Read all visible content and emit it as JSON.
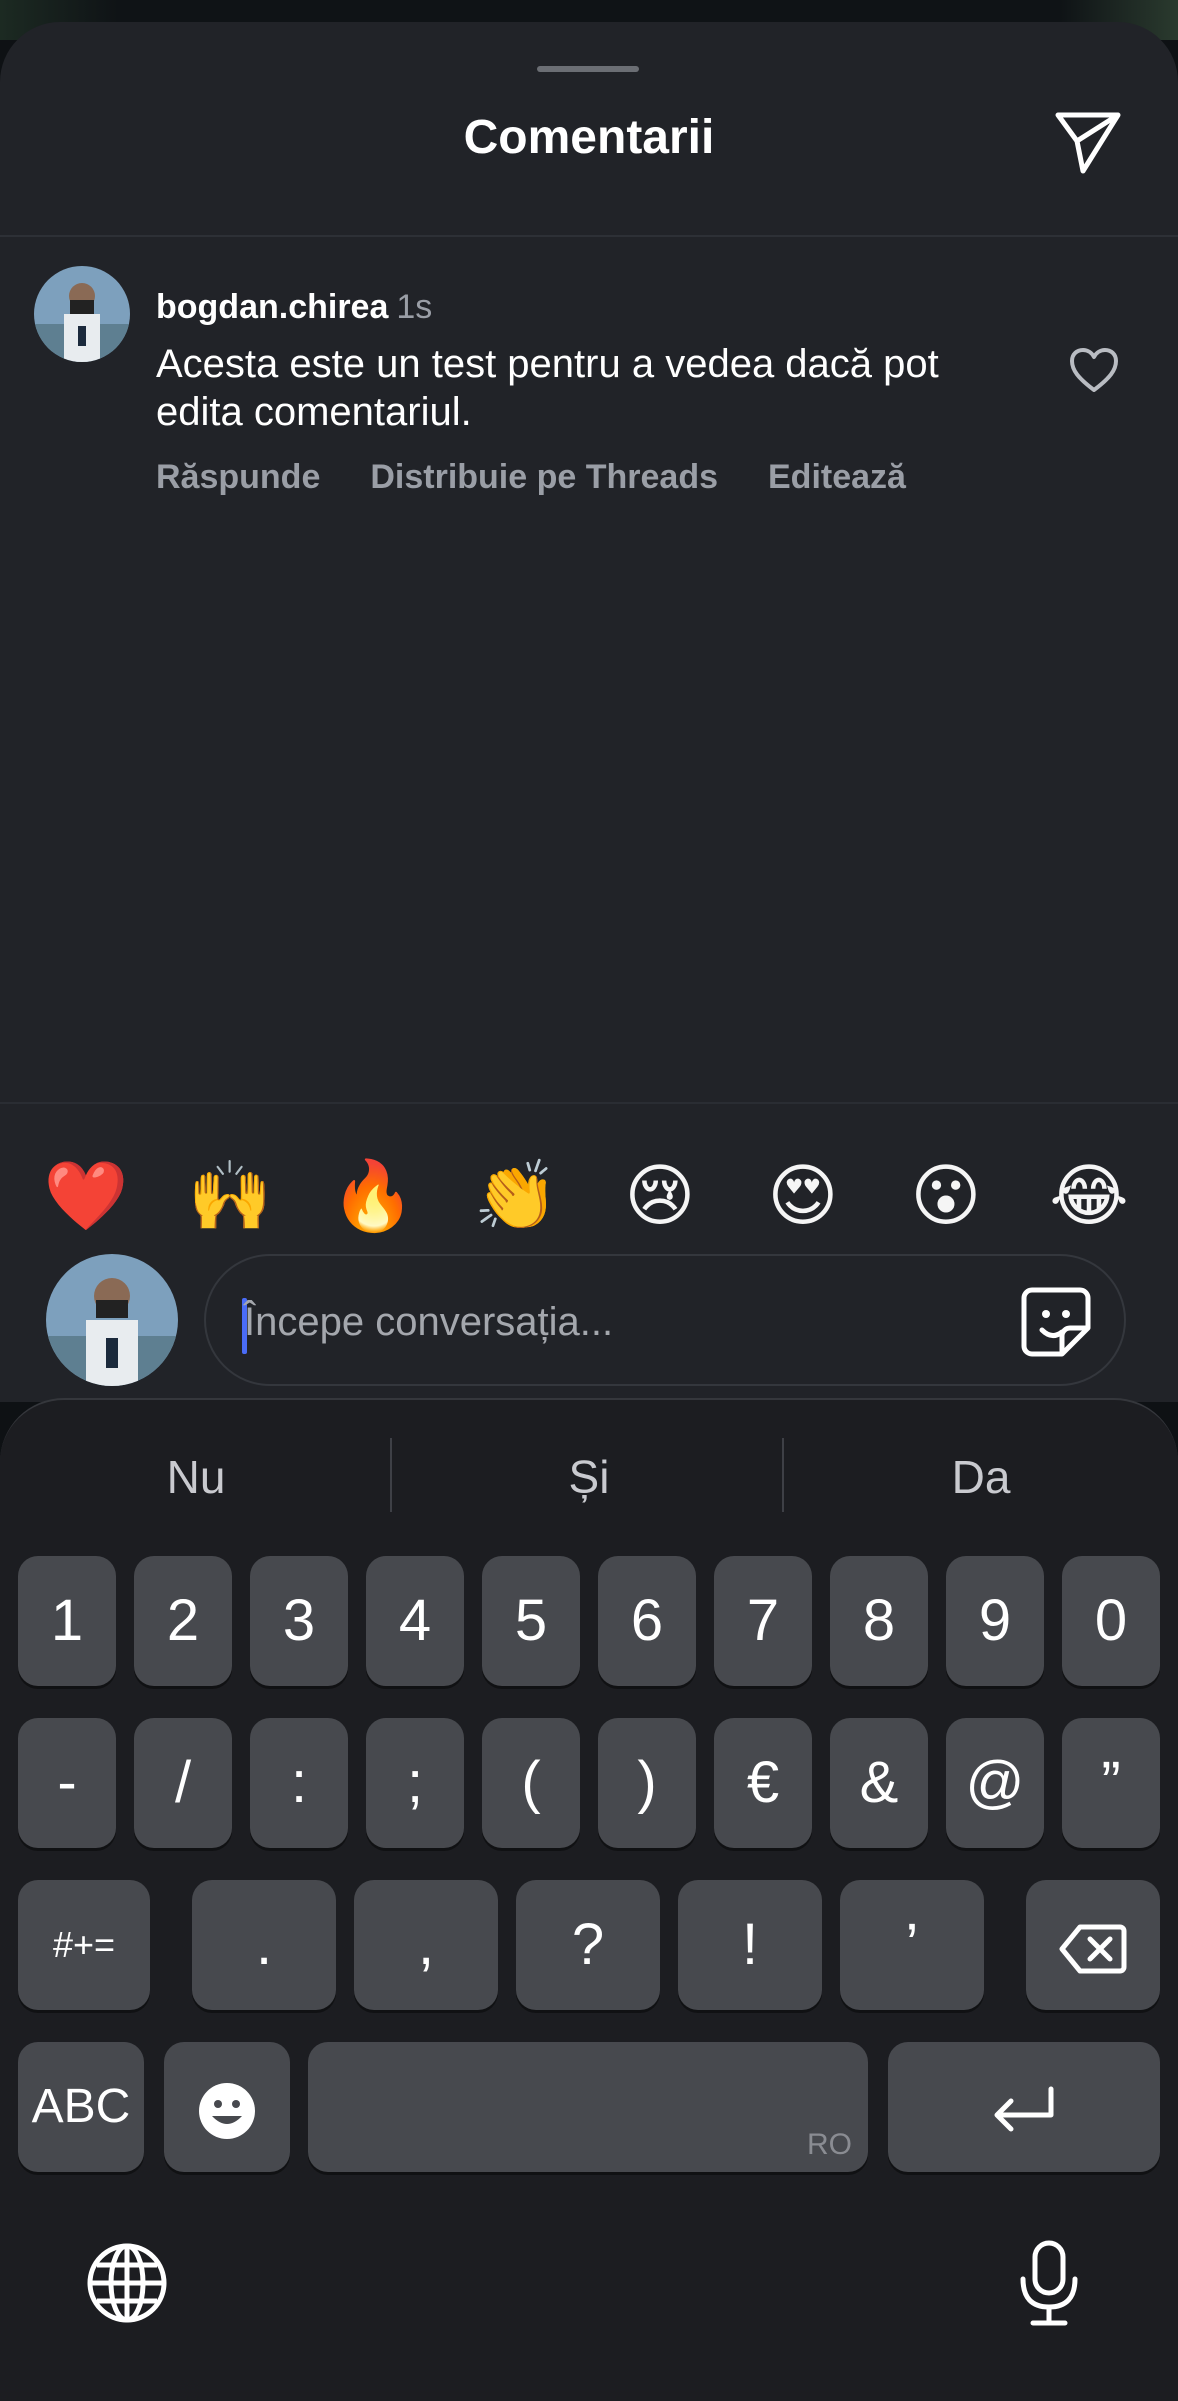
{
  "sheet": {
    "title": "Comentarii"
  },
  "comment": {
    "username": "bogdan.chirea",
    "time": "1s",
    "text": "Acesta este un test pentru a vedea dacă pot edita comentariul.",
    "actions": {
      "reply": "Răspunde",
      "share_threads": "Distribuie pe Threads",
      "edit": "Editează"
    }
  },
  "emoji_reactions": [
    "❤️",
    "🙌",
    "🔥",
    "👏",
    "😢",
    "😍",
    "😮",
    "😂"
  ],
  "composer": {
    "placeholder": "Începe conversația..."
  },
  "keyboard": {
    "suggestions": [
      "Nu",
      "Și",
      "Da"
    ],
    "row1": [
      "1",
      "2",
      "3",
      "4",
      "5",
      "6",
      "7",
      "8",
      "9",
      "0"
    ],
    "row2": [
      "-",
      "/",
      ":",
      ";",
      "(",
      ")",
      "€",
      "&",
      "@",
      "”"
    ],
    "row3": {
      "shift": "#+=",
      "keys": [
        ".",
        ",",
        "?",
        "!",
        "’"
      ]
    },
    "row4": {
      "abc": "ABC",
      "space_lang": "RO"
    }
  },
  "colors": {
    "sheet_bg": "#212328",
    "keyboard_bg": "#1c1d21",
    "key_bg": "#47494e",
    "caret": "#4a6cf7"
  }
}
